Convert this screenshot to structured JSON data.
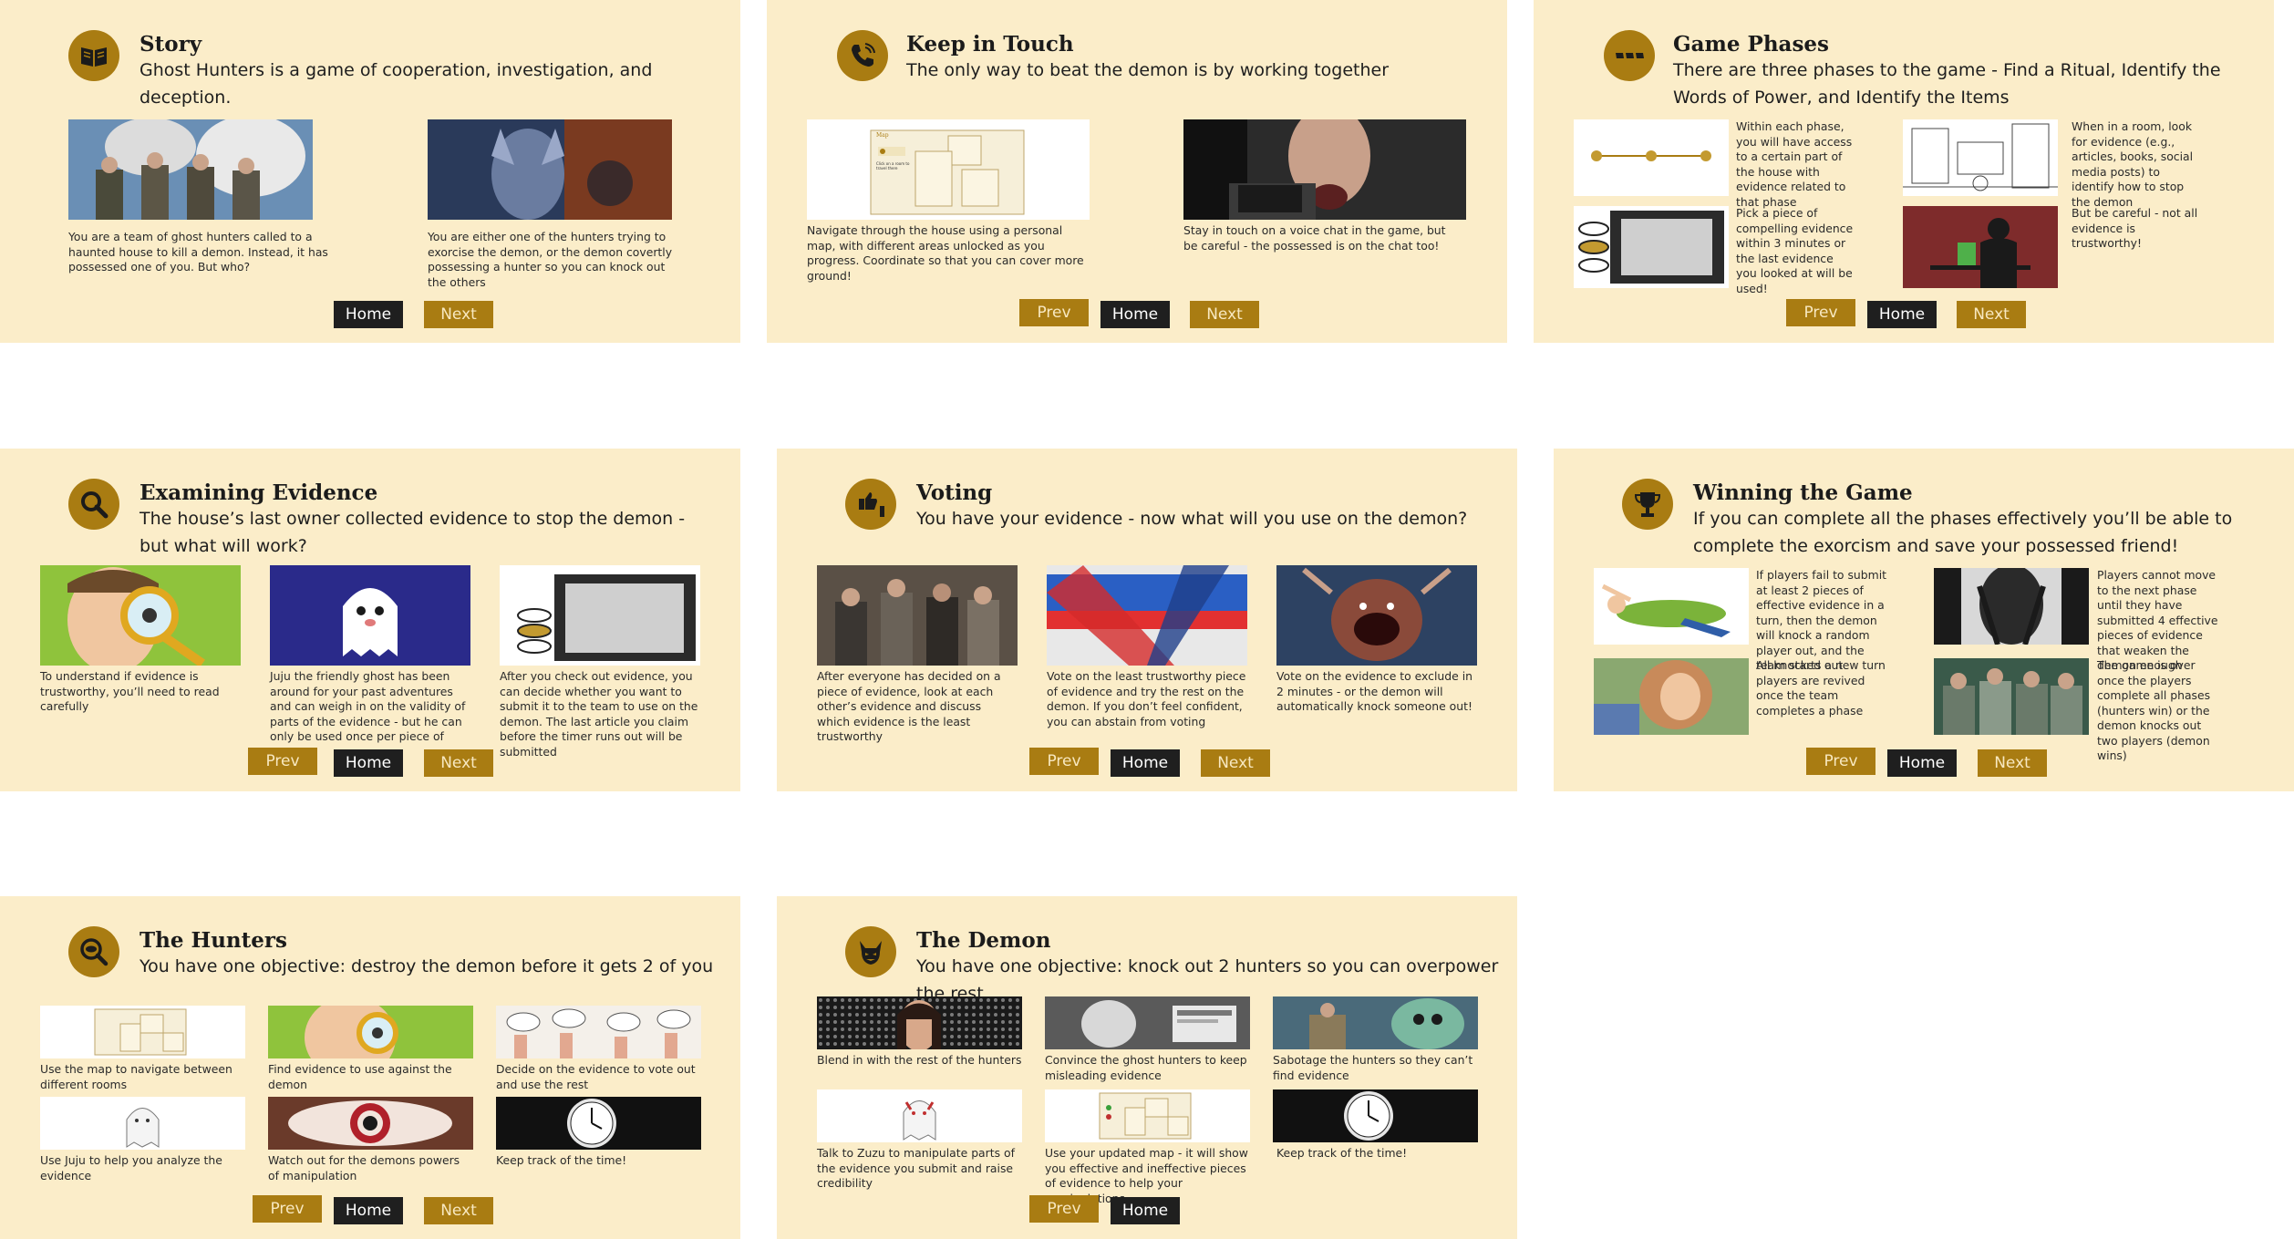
{
  "colors": {
    "panel_bg": "#fbedc9",
    "accent": "#a97c12",
    "home_button": "#1f1f1f"
  },
  "slides": [
    {
      "icon": "book-icon",
      "title": "Story",
      "subtitle": "Ghost Hunters is a game of cooperation, investigation, and deception.",
      "captions": [
        "You are a team of ghost hunters called to a haunted house to kill a demon. Instead, it has possessed one of you. But who?",
        "You are either one of the hunters trying to exorcise the demon, or the demon covertly possessing a hunter so you can knock out the others"
      ],
      "buttons": {
        "home": "Home",
        "next": "Next"
      }
    },
    {
      "icon": "phone-icon",
      "title": "Keep in Touch",
      "subtitle": "The only way to beat the demon is by working together",
      "captions": [
        "Navigate through the house using a personal map, with different areas unlocked as you progress. Coordinate so that you can cover more ground!",
        "Stay in touch on a voice chat in the game, but be careful - the possessed is on the chat too!"
      ],
      "map_label": "Map",
      "map_hint": "Click on a room to travel there",
      "buttons": {
        "prev": "Prev",
        "home": "Home",
        "next": "Next"
      }
    },
    {
      "icon": "dots-icon",
      "title": "Game Phases",
      "subtitle": "There are three phases to the game - Find a Ritual, Identify the Words of Power, and Identify the Items",
      "captions": [
        "Within each phase, you will have access to a certain part of the house with evidence related to that phase",
        "When in a room, look for evidence (e.g., articles, books, social media posts) to identify how to stop the demon",
        "Pick a piece of compelling evidence within 3 minutes or the last evidence you looked at will be used!",
        "But be careful - not all evidence is trustworthy!"
      ],
      "buttons": {
        "prev": "Prev",
        "home": "Home",
        "next": "Next"
      }
    },
    {
      "icon": "magnifier-icon",
      "title": "Examining Evidence",
      "subtitle": "The house’s last owner collected evidence to stop the demon - but what will work?",
      "captions": [
        "To understand if evidence is trustworthy, you’ll need to read carefully",
        "Juju the friendly ghost has been around for your past adventures and can weigh in on the validity of parts of the evidence - but he can only be used once per piece of news!",
        "After you check out evidence, you can decide whether you want to submit it to the team to use on the demon. The last article you claim before the timer runs out will be submitted"
      ],
      "buttons": {
        "prev": "Prev",
        "home": "Home",
        "next": "Next"
      }
    },
    {
      "icon": "thumbs-icon",
      "title": "Voting",
      "subtitle": "You have your evidence - now what will you use on the demon?",
      "captions": [
        "After everyone has decided on a piece of evidence, look at each other’s evidence and discuss which evidence is the least trustworthy",
        "Vote on the least trustworthy piece of evidence and try the rest on the demon. If you don’t feel confident, you can abstain from voting",
        "Vote on the evidence to exclude in 2 minutes - or the demon will automatically knock someone out!"
      ],
      "buttons": {
        "prev": "Prev",
        "home": "Home",
        "next": "Next"
      }
    },
    {
      "icon": "trophy-icon",
      "title": "Winning the Game",
      "subtitle": "If you can complete all the phases effectively you’ll be able to complete the exorcism and save your possessed friend!",
      "captions": [
        "If players fail to submit at least 2 pieces of effective evidence in a turn, then the demon will knock a random player out, and the team starts a new turn",
        "Players cannot move to the next phase until they have submitted  4 effective pieces of evidence that weaken the demon enough",
        "All knocked out players are revived once the team completes a phase",
        "The game is over once the players complete all phases (hunters win) or the demon knocks out two players (demon wins)"
      ],
      "buttons": {
        "prev": "Prev",
        "home": "Home",
        "next": "Next"
      }
    },
    {
      "icon": "eye-magnifier-icon",
      "title": "The Hunters",
      "subtitle": "You have one objective: destroy the demon before it gets 2 of you",
      "captions": [
        "Use the map to navigate between different rooms",
        "Find evidence to use against the demon",
        "Decide on the evidence to vote out and use the rest",
        "Use Juju to help you analyze the evidence",
        "Watch out for the demons powers of manipulation",
        "Keep track of the time!"
      ],
      "buttons": {
        "prev": "Prev",
        "home": "Home",
        "next": "Next"
      }
    },
    {
      "icon": "demon-icon",
      "title": "The Demon",
      "subtitle": "You have one objective: knock out 2 hunters so you can overpower the rest",
      "captions": [
        "Blend in with the rest of the hunters",
        "Convince the ghost hunters to keep misleading evidence",
        "Sabotage the hunters so they can’t find evidence",
        "Talk to Zuzu to manipulate parts of the evidence you submit and raise credibility",
        "Use your updated map - it will show you effective and ineffective pieces of evidence to help your manipulations",
        "Keep track of the time!"
      ],
      "buttons": {
        "prev": "Prev",
        "home": "Home"
      }
    }
  ]
}
